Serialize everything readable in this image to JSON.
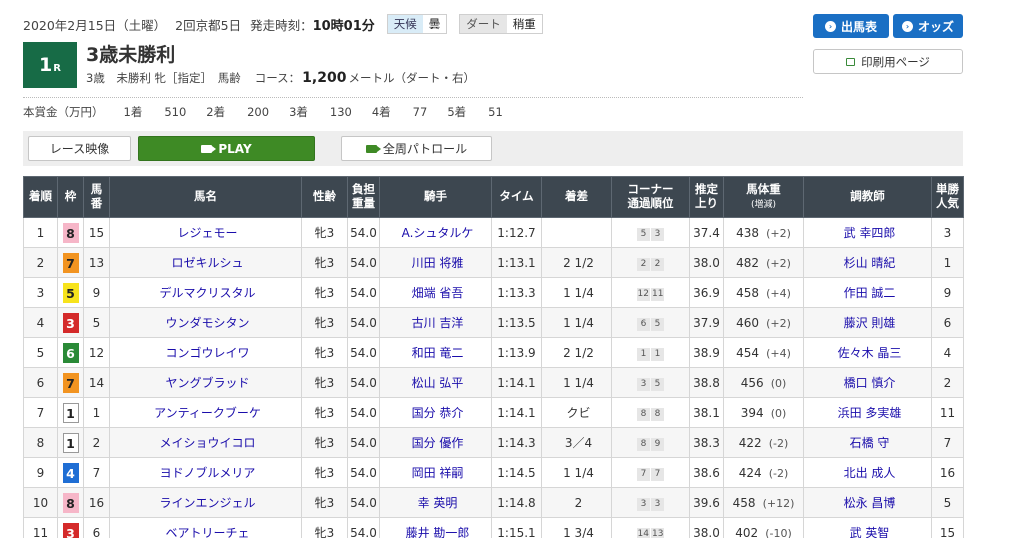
{
  "race_info": {
    "date": "2020年2月15日（土曜）",
    "meeting": "2回京都5日",
    "post_time_label": "発走時刻：",
    "post_time": "10時01分",
    "weather_label": "天候",
    "weather": "曇",
    "track_label": "ダート",
    "track_condition": "稍重"
  },
  "race": {
    "number": "1",
    "number_suffix": "R",
    "name": "3歳未勝利",
    "conditions": "3歳　未勝利 牝［指定］　馬齢",
    "course_label": "コース：",
    "distance": "1,200",
    "distance_unit": "メートル（ダート・右）"
  },
  "prize": {
    "label": "本賞金（万円）",
    "items": [
      {
        "place": "1着",
        "value": "510"
      },
      {
        "place": "2着",
        "value": "200"
      },
      {
        "place": "3着",
        "value": "130"
      },
      {
        "place": "4着",
        "value": "77"
      },
      {
        "place": "5着",
        "value": "51"
      }
    ]
  },
  "buttons": {
    "entries": "出馬表",
    "odds": "オッズ",
    "print": "印刷用ページ"
  },
  "video": {
    "label": "レース映像",
    "play": "PLAY",
    "patrol": "全周パトロール"
  },
  "colors": {
    "badge_green": "#176b46",
    "header_dark": "#3d4750",
    "button_blue": "#1a6fc4",
    "play_green": "#3e8a25",
    "frame": {
      "1": {
        "bg": "#ffffff",
        "fg": "#222222",
        "border": "#999999"
      },
      "3": {
        "bg": "#d42a2a",
        "fg": "#ffffff",
        "border": "#d42a2a"
      },
      "4": {
        "bg": "#1f6ed4",
        "fg": "#ffffff",
        "border": "#1f6ed4"
      },
      "5": {
        "bg": "#f7e31c",
        "fg": "#222222",
        "border": "#f7e31c"
      },
      "6": {
        "bg": "#2a8a37",
        "fg": "#ffffff",
        "border": "#2a8a37"
      },
      "7": {
        "bg": "#f29421",
        "fg": "#222222",
        "border": "#f29421"
      },
      "8": {
        "bg": "#f6b6c8",
        "fg": "#222222",
        "border": "#f6b6c8"
      }
    }
  },
  "table": {
    "headers": [
      {
        "l1": "着順",
        "l2": "",
        "small": ""
      },
      {
        "l1": "枠",
        "l2": "",
        "small": ""
      },
      {
        "l1": "馬",
        "l2": "番",
        "small": ""
      },
      {
        "l1": "馬名",
        "l2": "",
        "small": ""
      },
      {
        "l1": "性齢",
        "l2": "",
        "small": ""
      },
      {
        "l1": "負担",
        "l2": "重量",
        "small": ""
      },
      {
        "l1": "騎手",
        "l2": "",
        "small": ""
      },
      {
        "l1": "タイム",
        "l2": "",
        "small": ""
      },
      {
        "l1": "着差",
        "l2": "",
        "small": ""
      },
      {
        "l1": "コーナー",
        "l2": "通過順位",
        "small": ""
      },
      {
        "l1": "推定",
        "l2": "上り",
        "small": ""
      },
      {
        "l1": "馬体重",
        "l2": "",
        "small": "(増減)"
      },
      {
        "l1": "調教師",
        "l2": "",
        "small": ""
      },
      {
        "l1": "単勝",
        "l2": "人気",
        "small": ""
      }
    ],
    "rows": [
      {
        "pos": "1",
        "frame": "8",
        "num": "15",
        "horse": "レジェモー",
        "sex_age": "牝3",
        "weight": "54.0",
        "jockey": "A.シュタルケ",
        "time": "1:12.7",
        "margin": "",
        "corner": [
          "5",
          "3"
        ],
        "last3f": "37.4",
        "body": "438",
        "diff": "(+2)",
        "trainer": "武 幸四郎",
        "pop": "3"
      },
      {
        "pos": "2",
        "frame": "7",
        "num": "13",
        "horse": "ロゼキルシュ",
        "sex_age": "牝3",
        "weight": "54.0",
        "jockey": "川田 将雅",
        "time": "1:13.1",
        "margin": "2 1/2",
        "corner": [
          "2",
          "2"
        ],
        "last3f": "38.0",
        "body": "482",
        "diff": "(+2)",
        "trainer": "杉山 晴紀",
        "pop": "1"
      },
      {
        "pos": "3",
        "frame": "5",
        "num": "9",
        "horse": "デルマクリスタル",
        "sex_age": "牝3",
        "weight": "54.0",
        "jockey": "畑端 省吾",
        "time": "1:13.3",
        "margin": "1 1/4",
        "corner": [
          "12",
          "11"
        ],
        "last3f": "36.9",
        "body": "458",
        "diff": "(+4)",
        "trainer": "作田 誠二",
        "pop": "9"
      },
      {
        "pos": "4",
        "frame": "3",
        "num": "5",
        "horse": "ウンダモシタン",
        "sex_age": "牝3",
        "weight": "54.0",
        "jockey": "古川 吉洋",
        "time": "1:13.5",
        "margin": "1 1/4",
        "corner": [
          "6",
          "5"
        ],
        "last3f": "37.9",
        "body": "460",
        "diff": "(+2)",
        "trainer": "藤沢 則雄",
        "pop": "6"
      },
      {
        "pos": "5",
        "frame": "6",
        "num": "12",
        "horse": "コンゴウレイワ",
        "sex_age": "牝3",
        "weight": "54.0",
        "jockey": "和田 竜二",
        "time": "1:13.9",
        "margin": "2 1/2",
        "corner": [
          "1",
          "1"
        ],
        "last3f": "38.9",
        "body": "454",
        "diff": "(+4)",
        "trainer": "佐々木 晶三",
        "pop": "4"
      },
      {
        "pos": "6",
        "frame": "7",
        "num": "14",
        "horse": "ヤングブラッド",
        "sex_age": "牝3",
        "weight": "54.0",
        "jockey": "松山 弘平",
        "time": "1:14.1",
        "margin": "1 1/4",
        "corner": [
          "3",
          "5"
        ],
        "last3f": "38.8",
        "body": "456",
        "diff": "(0)",
        "trainer": "橋口 慎介",
        "pop": "2"
      },
      {
        "pos": "7",
        "frame": "1",
        "num": "1",
        "horse": "アンティークブーケ",
        "sex_age": "牝3",
        "weight": "54.0",
        "jockey": "国分 恭介",
        "time": "1:14.1",
        "margin": "クビ",
        "corner": [
          "8",
          "8"
        ],
        "last3f": "38.1",
        "body": "394",
        "diff": "(0)",
        "trainer": "浜田 多実雄",
        "pop": "11"
      },
      {
        "pos": "8",
        "frame": "1",
        "num": "2",
        "horse": "メイショウイコロ",
        "sex_age": "牝3",
        "weight": "54.0",
        "jockey": "国分 優作",
        "time": "1:14.3",
        "margin": "3／4",
        "corner": [
          "8",
          "9"
        ],
        "last3f": "38.3",
        "body": "422",
        "diff": "(-2)",
        "trainer": "石橋 守",
        "pop": "7"
      },
      {
        "pos": "9",
        "frame": "4",
        "num": "7",
        "horse": "ヨドノブルメリア",
        "sex_age": "牝3",
        "weight": "54.0",
        "jockey": "岡田 祥嗣",
        "time": "1:14.5",
        "margin": "1 1/4",
        "corner": [
          "7",
          "7"
        ],
        "last3f": "38.6",
        "body": "424",
        "diff": "(-2)",
        "trainer": "北出 成人",
        "pop": "16"
      },
      {
        "pos": "10",
        "frame": "8",
        "num": "16",
        "horse": "ラインエンジェル",
        "sex_age": "牝3",
        "weight": "54.0",
        "jockey": "幸 英明",
        "time": "1:14.8",
        "margin": "2",
        "corner": [
          "3",
          "3"
        ],
        "last3f": "39.6",
        "body": "458",
        "diff": "(+12)",
        "trainer": "松永 昌博",
        "pop": "5"
      },
      {
        "pos": "11",
        "frame": "3",
        "num": "6",
        "horse": "ベアトリーチェ",
        "sex_age": "牝3",
        "weight": "54.0",
        "jockey": "藤井 勘一郎",
        "time": "1:15.1",
        "margin": "1 3/4",
        "corner": [
          "14",
          "13"
        ],
        "last3f": "38.0",
        "body": "402",
        "diff": "(-10)",
        "trainer": "武 英智",
        "pop": "15"
      }
    ]
  }
}
